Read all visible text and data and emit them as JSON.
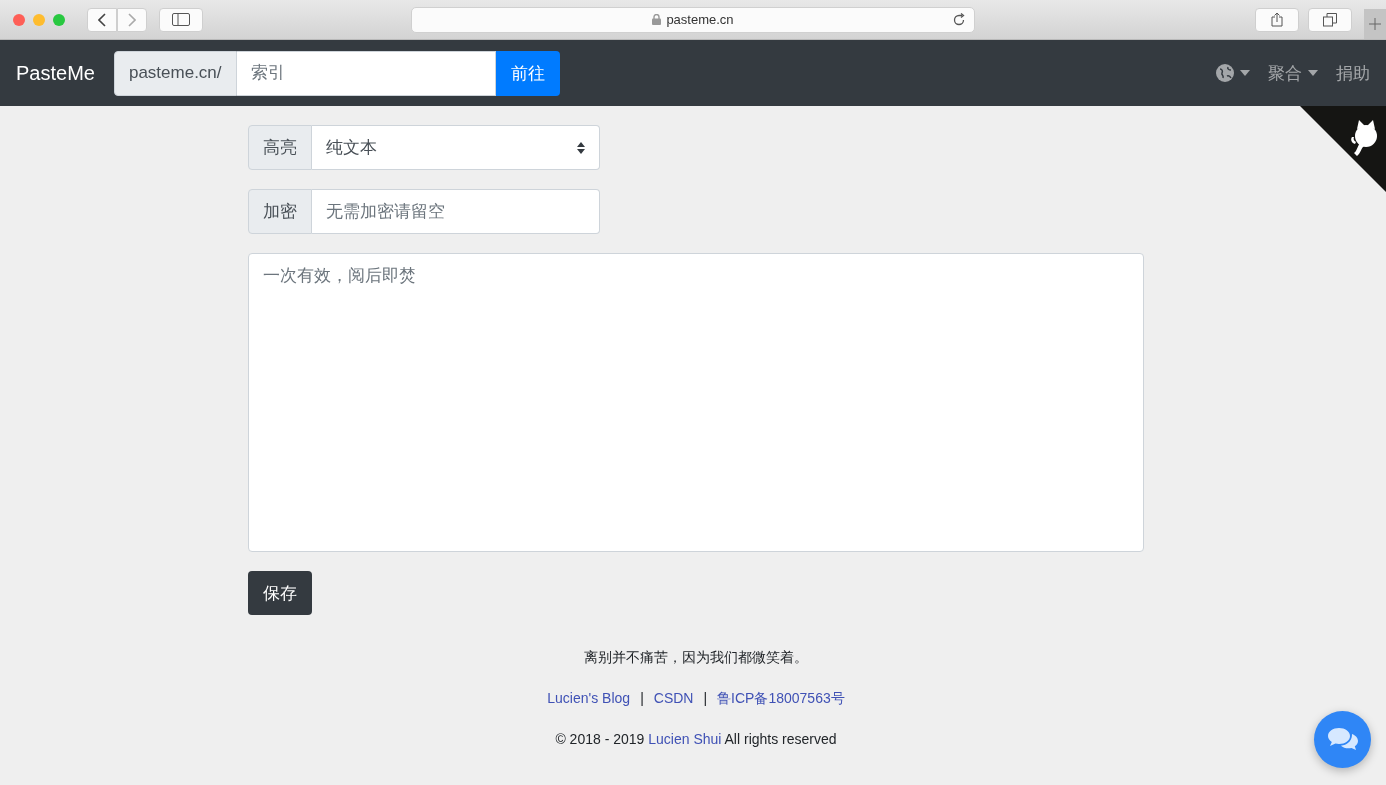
{
  "browser": {
    "address": "pasteme.cn"
  },
  "navbar": {
    "brand": "PasteMe",
    "prefix": "pasteme.cn/",
    "placeholder": "索引",
    "go_button": "前往",
    "menus": [
      {
        "label": "聚合",
        "dropdown": true
      },
      {
        "label": "捐助",
        "dropdown": false
      }
    ]
  },
  "form": {
    "highlight": {
      "label": "高亮",
      "value": "纯文本"
    },
    "password": {
      "label": "加密",
      "placeholder": "无需加密请留空"
    },
    "content": {
      "placeholder": "一次有效，阅后即焚"
    },
    "save_button": "保存"
  },
  "footer": {
    "motto": "离别并不痛苦，因为我们都微笑着。",
    "separator": "|",
    "links": [
      "Lucien's Blog",
      "CSDN",
      "鲁ICP备18007563号"
    ],
    "copyright": {
      "prefix": "© 2018 - 2019 ",
      "link": "Lucien Shui",
      "suffix": " All rights reserved"
    }
  }
}
